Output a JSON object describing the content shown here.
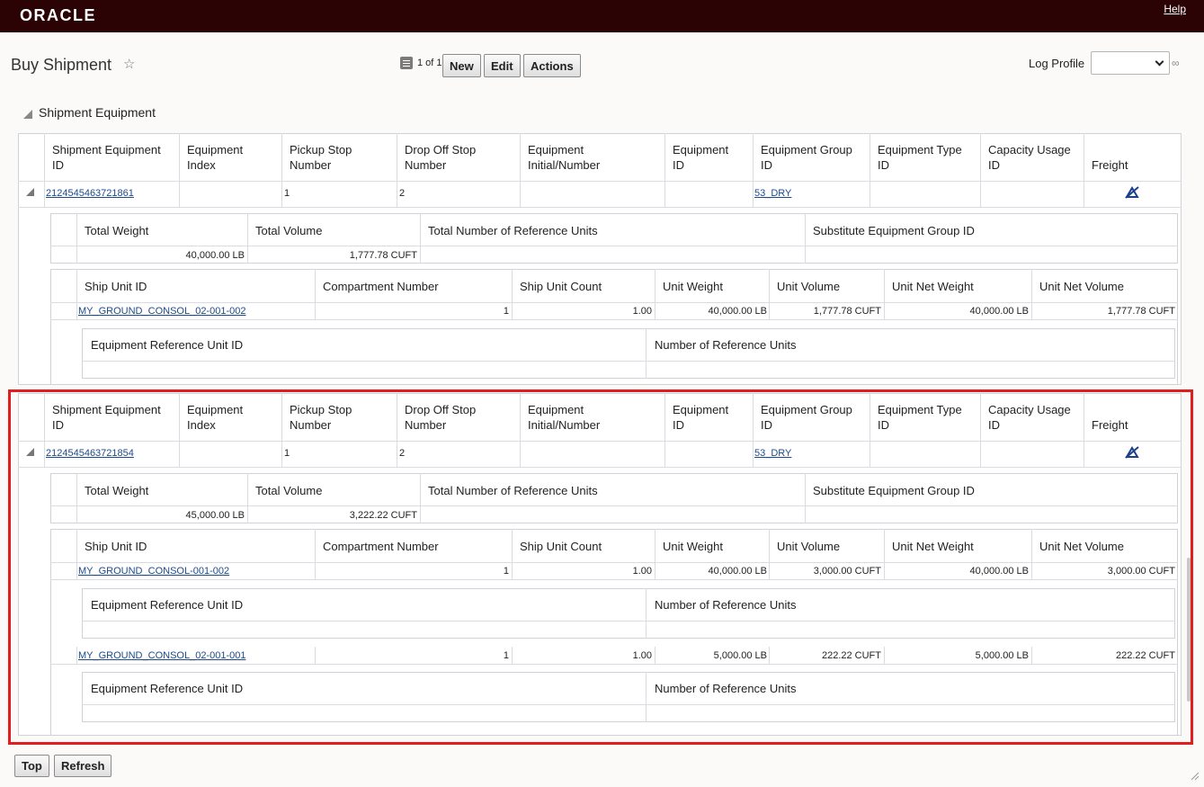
{
  "header": {
    "brand": "ORACLE",
    "help": "Help"
  },
  "page": {
    "title": "Buy Shipment",
    "pager": "1 of 1",
    "new": "New",
    "edit": "Edit",
    "actions": "Actions",
    "log_profile": "Log Profile"
  },
  "section": {
    "title": "Shipment Equipment"
  },
  "eq_cols": [
    "Shipment Equipment ID",
    "Equipment Index",
    "Pickup Stop Number",
    "Drop Off Stop Number",
    "Equipment Initial/Number",
    "Equipment ID",
    "Equipment Group ID",
    "Equipment Type ID",
    "Capacity Usage ID",
    "Freight"
  ],
  "eq_cols_l1": [
    "Shipment Equipment",
    "Equipment",
    "Pickup Stop",
    "Drop Off Stop",
    "Equipment",
    "Equipment",
    "Equipment Group",
    "Equipment Type",
    "Capacity Usage",
    ""
  ],
  "eq_cols_l2": [
    "ID",
    "Index",
    "Number",
    "Number",
    "Initial/Number",
    "ID",
    "ID",
    "ID",
    "ID",
    "Freight"
  ],
  "wt_cols": [
    "Total Weight",
    "Total Volume",
    "Total Number of Reference Units",
    "Substitute Equipment Group ID"
  ],
  "su_cols": [
    "Ship Unit ID",
    "Compartment Number",
    "Ship Unit Count",
    "Unit Weight",
    "Unit Volume",
    "Unit Net Weight",
    "Unit Net Volume"
  ],
  "ref_cols": [
    "Equipment Reference Unit ID",
    "Number of Reference Units"
  ],
  "equipment": [
    {
      "id": "2124545463721861",
      "pickup": "1",
      "dropoff": "2",
      "group": "53_DRY",
      "total_weight": "40,000.00 LB",
      "total_volume": "1,777.78 CUFT",
      "ship_units": [
        {
          "id": "MY_GROUND_CONSOL_02-001-002",
          "compartment": "1",
          "count": "1.00",
          "unit_weight": "40,000.00 LB",
          "unit_volume": "1,777.78 CUFT",
          "net_weight": "40,000.00 LB",
          "net_volume": "1,777.78 CUFT"
        }
      ]
    },
    {
      "id": "2124545463721854",
      "pickup": "1",
      "dropoff": "2",
      "group": "53_DRY",
      "total_weight": "45,000.00 LB",
      "total_volume": "3,222.22 CUFT",
      "ship_units": [
        {
          "id": "MY_GROUND_CONSOL-001-002",
          "compartment": "1",
          "count": "1.00",
          "unit_weight": "40,000.00 LB",
          "unit_volume": "3,000.00 CUFT",
          "net_weight": "40,000.00 LB",
          "net_volume": "3,000.00 CUFT"
        },
        {
          "id": "MY_GROUND_CONSOL_02-001-001",
          "compartment": "1",
          "count": "1.00",
          "unit_weight": "5,000.00 LB",
          "unit_volume": "222.22 CUFT",
          "net_weight": "5,000.00 LB",
          "net_volume": "222.22 CUFT"
        }
      ]
    }
  ],
  "footer": {
    "top": "Top",
    "refresh": "Refresh"
  }
}
